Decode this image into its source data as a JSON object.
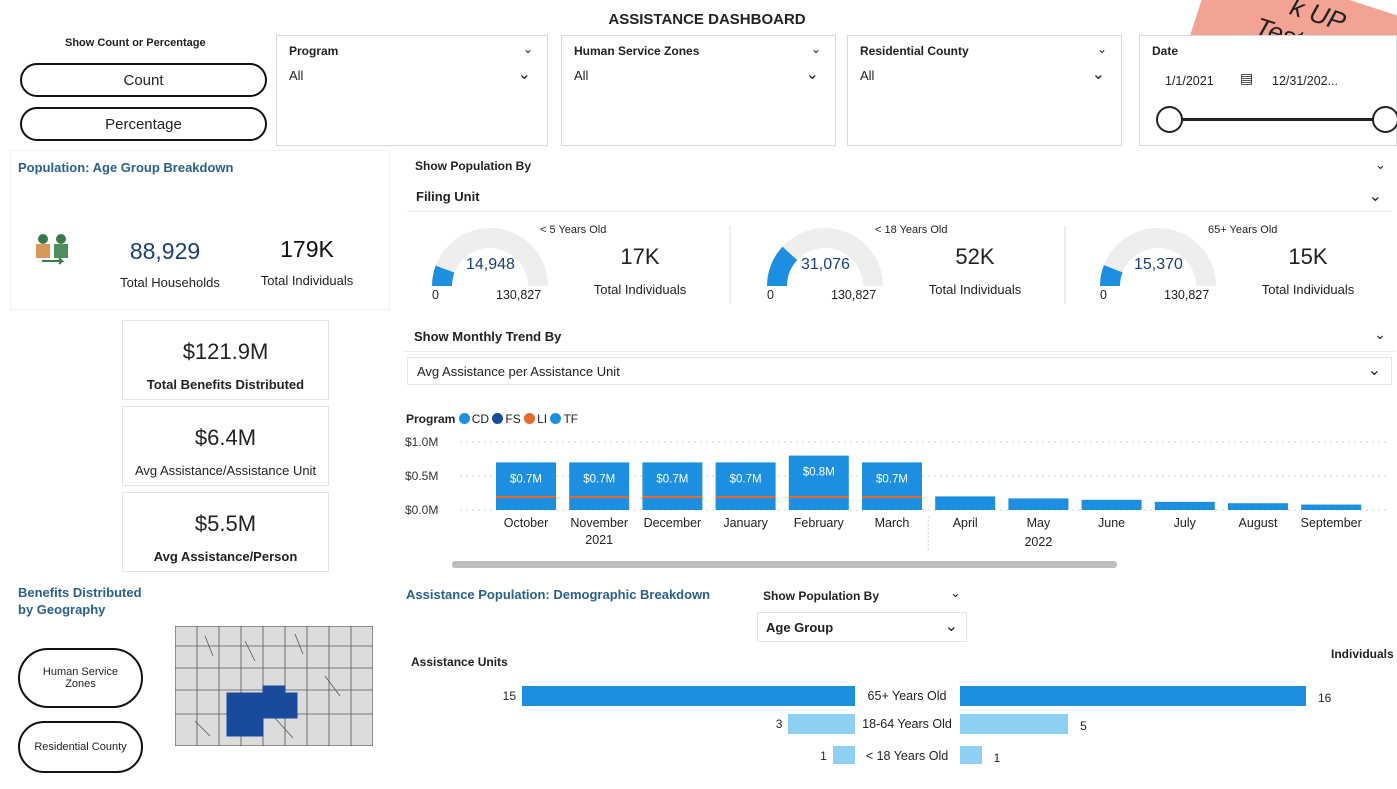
{
  "title": "ASSISTANCE DASHBOARD",
  "watermark": {
    "line1": "k UP",
    "line2": "Test Data"
  },
  "toggle": {
    "label": "Show Count or Percentage",
    "count": "Count",
    "percentage": "Percentage"
  },
  "slicers": {
    "program": {
      "label": "Program",
      "value": "All"
    },
    "zones": {
      "label": "Human Service Zones",
      "value": "All"
    },
    "county": {
      "label": "Residential County",
      "value": "All"
    },
    "date": {
      "label": "Date",
      "start": "1/1/2021",
      "end": "12/31/202..."
    }
  },
  "population": {
    "header": "Population: Age Group Breakdown",
    "total_households": "88,929",
    "total_households_label": "Total Households",
    "total_individuals": "179K",
    "total_individuals_label": "Total Individuals",
    "show_by_label": "Show Population By",
    "show_by_value": "Filing Unit",
    "gauges": [
      {
        "title": "< 5 Years Old",
        "value": "14,948",
        "min": "0",
        "max": "130,827",
        "fraction": 0.114,
        "individuals": "17K",
        "individuals_label": "Total Individuals"
      },
      {
        "title": "< 18 Years Old",
        "value": "31,076",
        "min": "0",
        "max": "130,827",
        "fraction": 0.238,
        "individuals": "52K",
        "individuals_label": "Total Individuals"
      },
      {
        "title": "65+ Years Old",
        "value": "15,370",
        "min": "0",
        "max": "130,827",
        "fraction": 0.117,
        "individuals": "15K",
        "individuals_label": "Total Individuals"
      }
    ]
  },
  "kpis": [
    {
      "value": "$121.9M",
      "label": "Total Benefits Distributed"
    },
    {
      "value": "$6.4M",
      "label": "Avg Assistance/Assistance Unit"
    },
    {
      "value": "$5.5M",
      "label": "Avg Assistance/Person"
    }
  ],
  "trend": {
    "show_by_label": "Show Monthly Trend By",
    "show_by_value": "Avg Assistance per Assistance Unit",
    "legend_title": "Program",
    "colors": {
      "CD": "#1f8fe0",
      "FS": "#1a4a9c",
      "LI": "#e8682a",
      "TF": "#1c8fe0"
    }
  },
  "chart_data": {
    "type": "bar",
    "categories": [
      "October",
      "November",
      "December",
      "January",
      "February",
      "March",
      "April",
      "May",
      "June",
      "July",
      "August",
      "September"
    ],
    "year_labels": [
      "2021",
      "2022"
    ],
    "legend": [
      "CD",
      "FS",
      "LI",
      "TF"
    ],
    "values": [
      0.7,
      0.7,
      0.7,
      0.7,
      0.8,
      0.7,
      0.2,
      0.17,
      0.15,
      0.12,
      0.1,
      0.08
    ],
    "data_labels": [
      "$0.7M",
      "$0.7M",
      "$0.7M",
      "$0.7M",
      "$0.8M",
      "$0.7M",
      "",
      "",
      "",
      "",
      "",
      ""
    ],
    "y_ticks": [
      "$1.0M",
      "$0.5M",
      "$0.0M"
    ],
    "ylim": [
      0,
      1.0
    ]
  },
  "geo": {
    "header_line1": "Benefits Distributed",
    "header_line2": "by Geography",
    "zones_btn_line1": "Human Service",
    "zones_btn_line2": "Zones",
    "county_btn": "Residential County"
  },
  "demographic": {
    "header": "Assistance Population: Demographic Breakdown",
    "show_by_label": "Show Population By",
    "show_by_value": "Age Group",
    "left_title": "Assistance Units",
    "right_title": "Individuals",
    "rows": [
      {
        "label": "65+ Years Old",
        "units": 15,
        "individuals": 16
      },
      {
        "label": "18-64 Years Old",
        "units": 3,
        "individuals": 5
      },
      {
        "label": "< 18 Years Old",
        "units": 1,
        "individuals": 1
      }
    ]
  }
}
